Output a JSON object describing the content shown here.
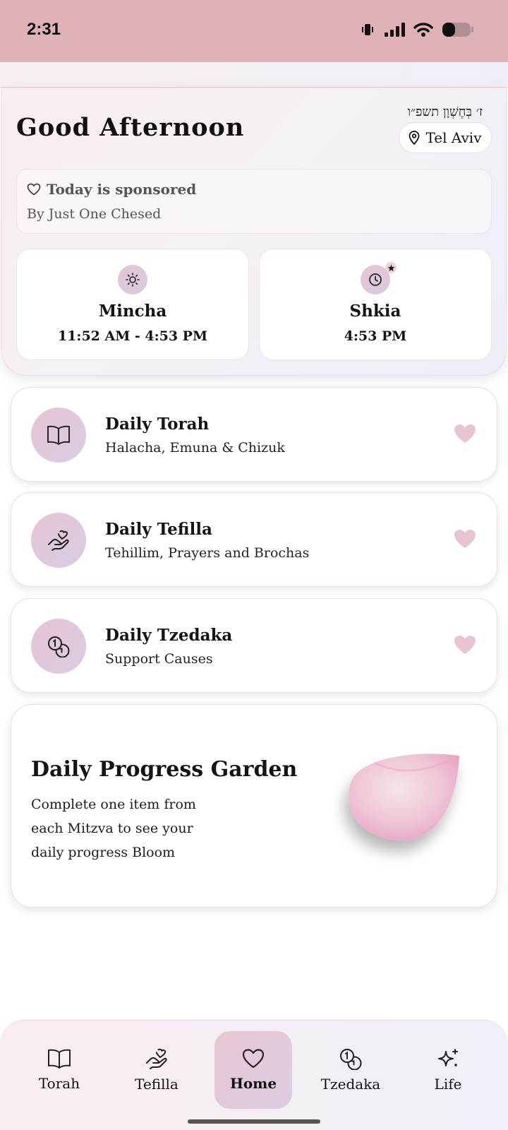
{
  "status_bar": {
    "time": "2:31"
  },
  "header": {
    "hebrew_date": "ז׳ בְּחֶשְׁוָן תשפ״ו",
    "greeting": "Good Afternoon",
    "location": "Tel Aviv"
  },
  "sponsor": {
    "title": "Today is sponsored",
    "subtitle": "By Just One Chesed"
  },
  "times": [
    {
      "title": "Mincha",
      "time": "11:52 AM - 4:53 PM",
      "icon": "sun-icon"
    },
    {
      "title": "Shkia",
      "time": "4:53 PM",
      "icon": "clock-icon"
    }
  ],
  "daily_items": [
    {
      "title": "Daily Torah",
      "subtitle": "Halacha, Emuna & Chizuk",
      "icon": "book-icon"
    },
    {
      "title": "Daily Tefilla",
      "subtitle": "Tehillim, Prayers and Brochas",
      "icon": "hand-heart-icon"
    },
    {
      "title": "Daily Tzedaka",
      "subtitle": "Support Causes",
      "icon": "coins-icon"
    }
  ],
  "garden": {
    "title": "Daily Progress Garden",
    "description": "Complete one item from each Mitzva to see your daily progress Bloom"
  },
  "nav": {
    "items": [
      {
        "label": "Torah",
        "icon": "book-icon"
      },
      {
        "label": "Tefilla",
        "icon": "hand-heart-icon"
      },
      {
        "label": "Home",
        "icon": "heart-icon",
        "active": true
      },
      {
        "label": "Tzedaka",
        "icon": "coins-icon"
      },
      {
        "label": "Life",
        "icon": "sparkles-icon"
      }
    ]
  },
  "colors": {
    "status_bar": "#dfb1b8",
    "accent_pink": "#e7c4d3",
    "accent_lavender": "#d8cde3",
    "heart": "#e7c4d3"
  }
}
